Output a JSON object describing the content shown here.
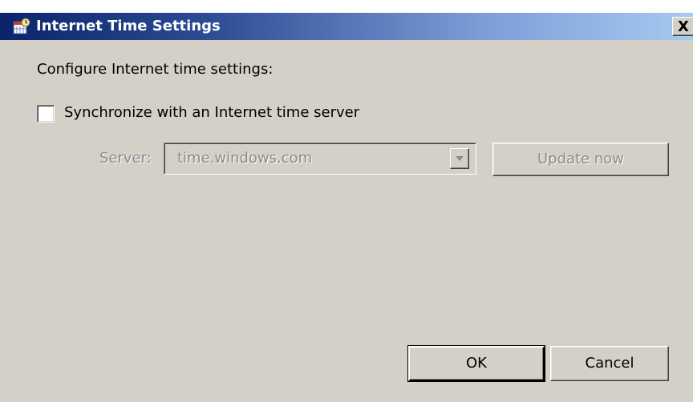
{
  "window": {
    "title": "Internet Time Settings",
    "close_label": "X",
    "icon": "clock-calendar-icon"
  },
  "main": {
    "heading": "Configure Internet time settings:",
    "sync_label": "Synchronize with an Internet time server",
    "sync_checked": false,
    "server_label": "Server:",
    "server_value": "time.windows.com",
    "server_enabled": false,
    "update_label": "Update now",
    "update_enabled": false
  },
  "footer": {
    "ok_label": "OK",
    "cancel_label": "Cancel"
  },
  "colors": {
    "title_start": "#0a246a",
    "title_end": "#a6caf0",
    "dialog_bg": "#d4d0c8",
    "disabled_text": "#8a8a8a"
  }
}
